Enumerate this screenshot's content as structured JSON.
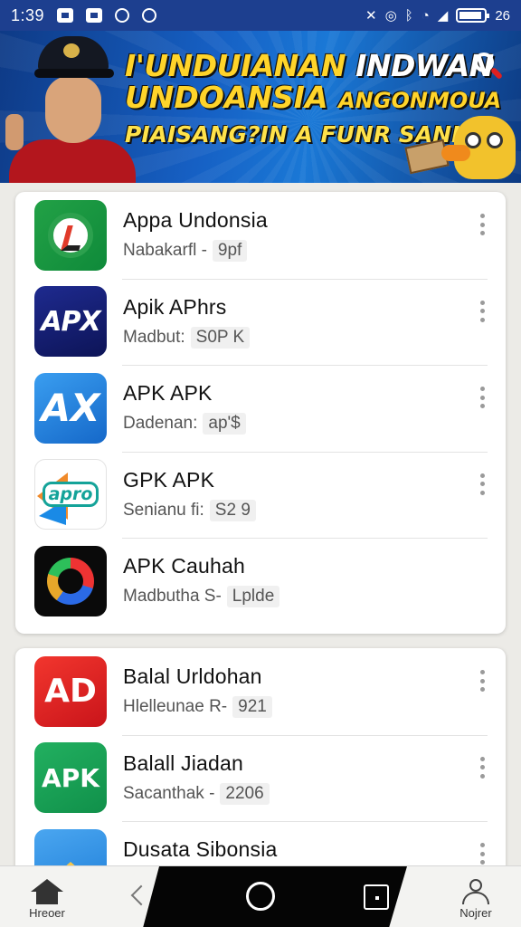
{
  "status_bar": {
    "time": "1:39",
    "battery": "26"
  },
  "banner": {
    "line1_a": "I'UNDUIANAN",
    "line1_b": "INDWAN",
    "line2_a": "UNDOANSIA",
    "line2_b": "ANGONMOUA",
    "line3": "PIAISANG?IN A FUNR SANIAN"
  },
  "lists": [
    {
      "apps": [
        {
          "name": "Appa Undonsia",
          "sub": "Nabakarfl  -",
          "tag": "9pf",
          "icon_text": ""
        },
        {
          "name": "Apik APhrs",
          "sub": "Madbut:",
          "tag": "S0P K",
          "icon_text": "APX"
        },
        {
          "name": "APK APK",
          "sub": "Dadenan:",
          "tag": "ap'$",
          "icon_text": "AX"
        },
        {
          "name": "GPK APK",
          "sub": "Senianu fi:",
          "tag": "S2 9",
          "icon_text": "apro"
        },
        {
          "name": "APK Cauhah",
          "sub": "Madbutha S-",
          "tag": "Lplde",
          "icon_text": ""
        }
      ]
    },
    {
      "apps": [
        {
          "name": "Balal Urldohan",
          "sub": "Hlelleunae R-",
          "tag": "921",
          "icon_text": "AD"
        },
        {
          "name": "Balall Jiadan",
          "sub": "Sacanthak -",
          "tag": "2206",
          "icon_text": "APK"
        },
        {
          "name": "Dusata Sibonsia",
          "sub": "",
          "tag": "",
          "icon_text": ""
        }
      ]
    }
  ],
  "bottom_nav": {
    "home_label": "Hreoer",
    "profile_label": "Nojrer"
  }
}
